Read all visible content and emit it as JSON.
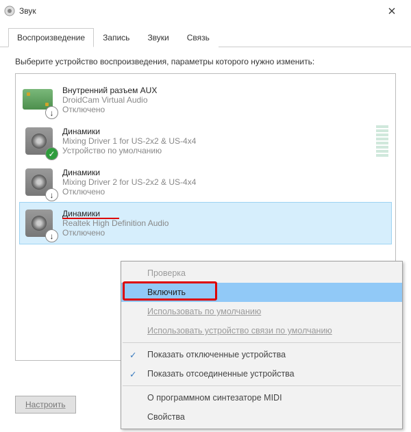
{
  "window": {
    "title": "Звук"
  },
  "tabs": [
    "Воспроизведение",
    "Запись",
    "Звуки",
    "Связь"
  ],
  "active_tab": 0,
  "instruction": "Выберите устройство воспроизведения, параметры которого нужно изменить:",
  "devices": [
    {
      "name": "Внутренний разъем  AUX",
      "sub": "DroidCam Virtual Audio",
      "status": "Отключено",
      "icon": "aux-board",
      "badge": "arrow-down",
      "selected": false
    },
    {
      "name": "Динамики",
      "sub": "Mixing Driver 1 for US-2x2 & US-4x4",
      "status": "Устройство по умолчанию",
      "icon": "speaker",
      "badge": "check-green",
      "selected": false,
      "levels": true
    },
    {
      "name": "Динамики",
      "sub": "Mixing Driver 2 for US-2x2 & US-4x4",
      "status": "Отключено",
      "icon": "speaker",
      "badge": "arrow-down",
      "selected": false
    },
    {
      "name": "Динамики",
      "sub": "Realtek High Definition Audio",
      "status": "Отключено",
      "icon": "speaker",
      "badge": "arrow-down",
      "selected": true,
      "red_mark": true
    }
  ],
  "configure_btn": "Настроить",
  "context_menu": {
    "items": [
      {
        "label": "Проверка",
        "disabled": true
      },
      {
        "label": "Включить",
        "selected": true,
        "red_box": true
      },
      {
        "label": "Использовать по умолчанию",
        "disabled": true
      },
      {
        "label": "Использовать устройство связи по умолчанию",
        "disabled": true
      },
      {
        "sep": true
      },
      {
        "label": "Показать отключенные устройства",
        "checked": true
      },
      {
        "label": "Показать отсоединенные устройства",
        "checked": true
      },
      {
        "sep": true
      },
      {
        "label": "О программном синтезаторе MIDI",
        "ul_index": 0
      },
      {
        "label": "Свойства",
        "ul_index": 3
      }
    ]
  }
}
